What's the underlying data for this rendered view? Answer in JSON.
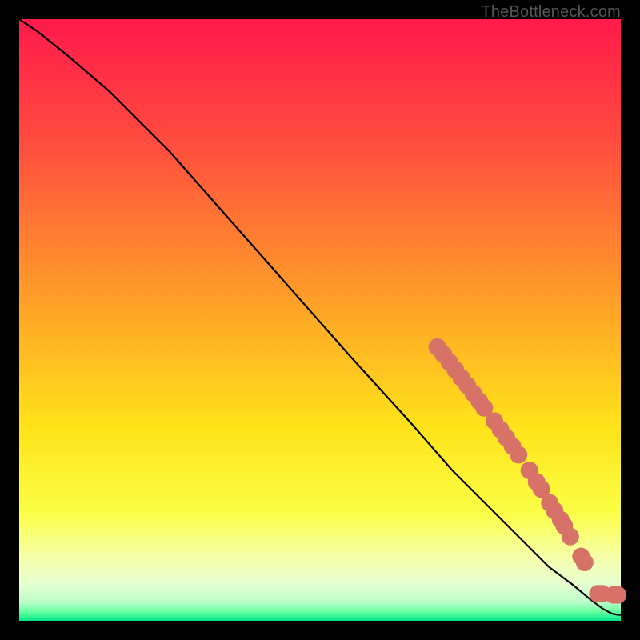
{
  "watermark": "TheBottleneck.com",
  "colors": {
    "curve": "#000000",
    "marker_fill": "#d77268",
    "marker_stroke": "#d77268",
    "gradient_stops": [
      {
        "offset": 0.0,
        "color": "#ff1a4b"
      },
      {
        "offset": 0.2,
        "color": "#ff4b3f"
      },
      {
        "offset": 0.45,
        "color": "#ff9a29"
      },
      {
        "offset": 0.68,
        "color": "#ffe41a"
      },
      {
        "offset": 0.82,
        "color": "#fcff46"
      },
      {
        "offset": 0.9,
        "color": "#f5ffb0"
      },
      {
        "offset": 0.94,
        "color": "#e5ffd0"
      },
      {
        "offset": 0.97,
        "color": "#b8ffc8"
      },
      {
        "offset": 0.985,
        "color": "#66ff9f"
      },
      {
        "offset": 1.0,
        "color": "#00e58a"
      }
    ]
  },
  "chart_data": {
    "type": "line",
    "title": "",
    "xlabel": "",
    "ylabel": "",
    "xlim": [
      0,
      100
    ],
    "ylim": [
      0,
      100
    ],
    "grid": false,
    "legend": false,
    "series": [
      {
        "name": "curve",
        "kind": "line",
        "x": [
          0,
          3,
          8,
          15,
          25,
          40,
          55,
          65,
          72,
          78,
          84,
          88,
          92,
          95,
          97,
          98.5,
          99.5,
          100
        ],
        "y": [
          100,
          98,
          94,
          88,
          78,
          61,
          44,
          33,
          25,
          19,
          13,
          9,
          6,
          3.5,
          2,
          1.2,
          1,
          1
        ]
      },
      {
        "name": "cluster-markers",
        "kind": "scatter",
        "marker_size": 11,
        "points": [
          {
            "x": 69.5,
            "y": 45.5
          },
          {
            "x": 70.5,
            "y": 44.3
          },
          {
            "x": 71.5,
            "y": 43.0
          },
          {
            "x": 72.5,
            "y": 41.7
          },
          {
            "x": 73.5,
            "y": 40.4
          },
          {
            "x": 74.5,
            "y": 39.1
          },
          {
            "x": 75.5,
            "y": 37.8
          },
          {
            "x": 76.5,
            "y": 36.5
          },
          {
            "x": 77.3,
            "y": 35.4
          },
          {
            "x": 79.0,
            "y": 33.2
          },
          {
            "x": 80.0,
            "y": 31.8
          },
          {
            "x": 81.0,
            "y": 30.4
          },
          {
            "x": 82.0,
            "y": 29.0
          },
          {
            "x": 83.0,
            "y": 27.6
          },
          {
            "x": 84.8,
            "y": 25.0
          },
          {
            "x": 86.0,
            "y": 23.1
          },
          {
            "x": 86.8,
            "y": 21.9
          },
          {
            "x": 88.2,
            "y": 19.6
          },
          {
            "x": 89.0,
            "y": 18.3
          },
          {
            "x": 90.0,
            "y": 16.8
          },
          {
            "x": 90.6,
            "y": 15.8
          },
          {
            "x": 91.6,
            "y": 14.0
          },
          {
            "x": 93.4,
            "y": 10.7
          },
          {
            "x": 94.0,
            "y": 9.7
          },
          {
            "x": 96.2,
            "y": 4.5
          },
          {
            "x": 96.9,
            "y": 4.5
          },
          {
            "x": 98.8,
            "y": 4.3
          },
          {
            "x": 99.5,
            "y": 4.3
          }
        ]
      }
    ]
  }
}
